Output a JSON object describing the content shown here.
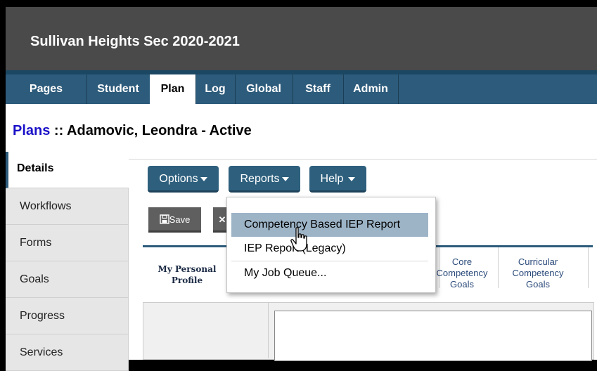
{
  "app": {
    "title": "Sullivan Heights Sec 2020-2021"
  },
  "nav": {
    "tabs": [
      {
        "label": "Pages"
      },
      {
        "label": "Student"
      },
      {
        "label": "Plan"
      },
      {
        "label": "Log"
      },
      {
        "label": "Global"
      },
      {
        "label": "Staff"
      },
      {
        "label": "Admin"
      }
    ],
    "active": "Plan"
  },
  "heading": {
    "link": "Plans",
    "rest": " :: Adamovic, Leondra - Active"
  },
  "sidebar": {
    "items": [
      {
        "label": "Details"
      },
      {
        "label": "Workflows"
      },
      {
        "label": "Forms"
      },
      {
        "label": "Goals"
      },
      {
        "label": "Progress"
      },
      {
        "label": "Services"
      }
    ]
  },
  "toolbar": {
    "options_label": "Options",
    "reports_label": "Reports",
    "help_label": "Help",
    "save_label": "Save"
  },
  "reports_menu": {
    "items": [
      {
        "label": "Competency Based IEP Report"
      },
      {
        "label": "IEP Report (Legacy)"
      },
      {
        "label": "My Job Queue..."
      }
    ],
    "highlighted_index": 0
  },
  "subtabs": {
    "first": {
      "line1": "My Personal",
      "line2": "Profile"
    },
    "core": {
      "line1": "Core",
      "line2": "Competency",
      "line3": "Goals"
    },
    "curricular": {
      "line1": "Curricular",
      "line2": "Competency",
      "line3": "Goals"
    }
  },
  "colors": {
    "nav": "#2d5b7b",
    "topbar": "#4a4a4a",
    "highlight": "#9db4c7",
    "link": "#1a10c8"
  }
}
